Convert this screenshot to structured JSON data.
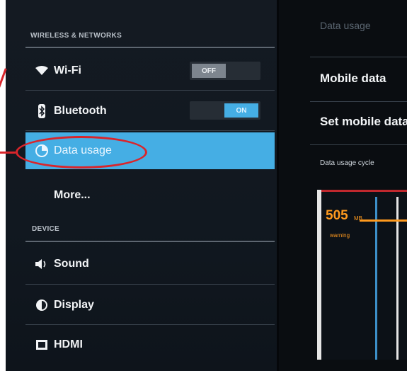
{
  "settings": {
    "sections": {
      "wireless": "WIRELESS & NETWORKS",
      "device": "DEVICE"
    },
    "items": {
      "wifi": {
        "label": "Wi-Fi",
        "icon": "wifi-icon",
        "toggle": "OFF"
      },
      "bluetooth": {
        "label": "Bluetooth",
        "icon": "bluetooth-icon",
        "toggle": "ON"
      },
      "data_usage": {
        "label": "Data usage",
        "icon": "data-usage-icon",
        "selected": true
      },
      "more": {
        "label": "More..."
      },
      "sound": {
        "label": "Sound",
        "icon": "speaker-icon"
      },
      "display": {
        "label": "Display",
        "icon": "brightness-icon"
      },
      "hdmi": {
        "label": "HDMI",
        "icon": "hdmi-icon"
      }
    }
  },
  "detail": {
    "title": "Data usage",
    "mobile_data": "Mobile data",
    "set_mobile_data": "Set mobile data",
    "cycle_label": "Data usage cycle",
    "graph": {
      "value": "505",
      "unit": "MB",
      "warning_label": "warning"
    }
  },
  "colors": {
    "selected": "#45aee4",
    "annotation": "#d9252b",
    "warning": "#ff9a1e"
  }
}
